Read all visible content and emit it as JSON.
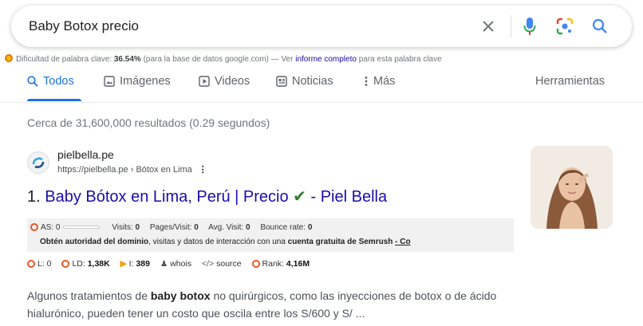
{
  "search": {
    "query": "Baby Botox precio",
    "icons": [
      "close-icon",
      "microphone-icon",
      "lens-icon",
      "search-icon"
    ]
  },
  "keyword_difficulty": {
    "label": "Dificultad de palabra clave:",
    "value": "36.54%",
    "note": "(para la base de datos google.com) — Ver",
    "link": "informe completo",
    "tail": "para esta palabra clave"
  },
  "tabs": [
    {
      "label": "Todos",
      "icon": "search-icon",
      "active": true
    },
    {
      "label": "Imágenes",
      "icon": "image-icon"
    },
    {
      "label": "Videos",
      "icon": "play-icon"
    },
    {
      "label": "Noticias",
      "icon": "news-icon"
    },
    {
      "label": "Más",
      "icon": "more-vert-icon"
    },
    {
      "label": "Herramientas"
    }
  ],
  "stats": "Cerca de 31,600,000 resultados (0.29 segundos)",
  "result": {
    "site_name": "pielbella.pe",
    "url": "https://pielbella.pe › Bótox en Lima",
    "number": "1.",
    "title": "Baby Bótox en Lima, Perú | Precio",
    "title_suffix": "- Piel Bella",
    "semrush_row1": {
      "as": "AS: 0",
      "visits_label": "Visits:",
      "visits": "0",
      "ppv_label": "Pages/Visit:",
      "ppv": "0",
      "avg_label": "Avg. Visit:",
      "avg": "0",
      "bounce_label": "Bounce rate:",
      "bounce": "0"
    },
    "semrush_row2": {
      "prefix": "Obtén",
      "bold1": "autoridad del dominio",
      "mid": ", visitas y datos de interacción con una",
      "bold2": "cuenta gratuita de Semrush",
      "link": "- Co"
    },
    "seo": {
      "l": "L: 0",
      "ld_label": "LD:",
      "ld": "1,38K",
      "i_label": "I:",
      "i": "389",
      "whois": "whois",
      "source": "source",
      "rank_label": "Rank:",
      "rank": "4,16M"
    },
    "snippet": {
      "p1": "Algunos tratamientos de",
      "bold": "baby botox",
      "p2": "no quirúrgicos, como las inyecciones de botox o de ácido hialurónico, pueden tener un costo que oscila entre los S/600 y S/ ..."
    }
  },
  "colors": {
    "link": "#1a0dab",
    "accent": "#1a73e8",
    "semrush_orange": "#e8582a"
  }
}
